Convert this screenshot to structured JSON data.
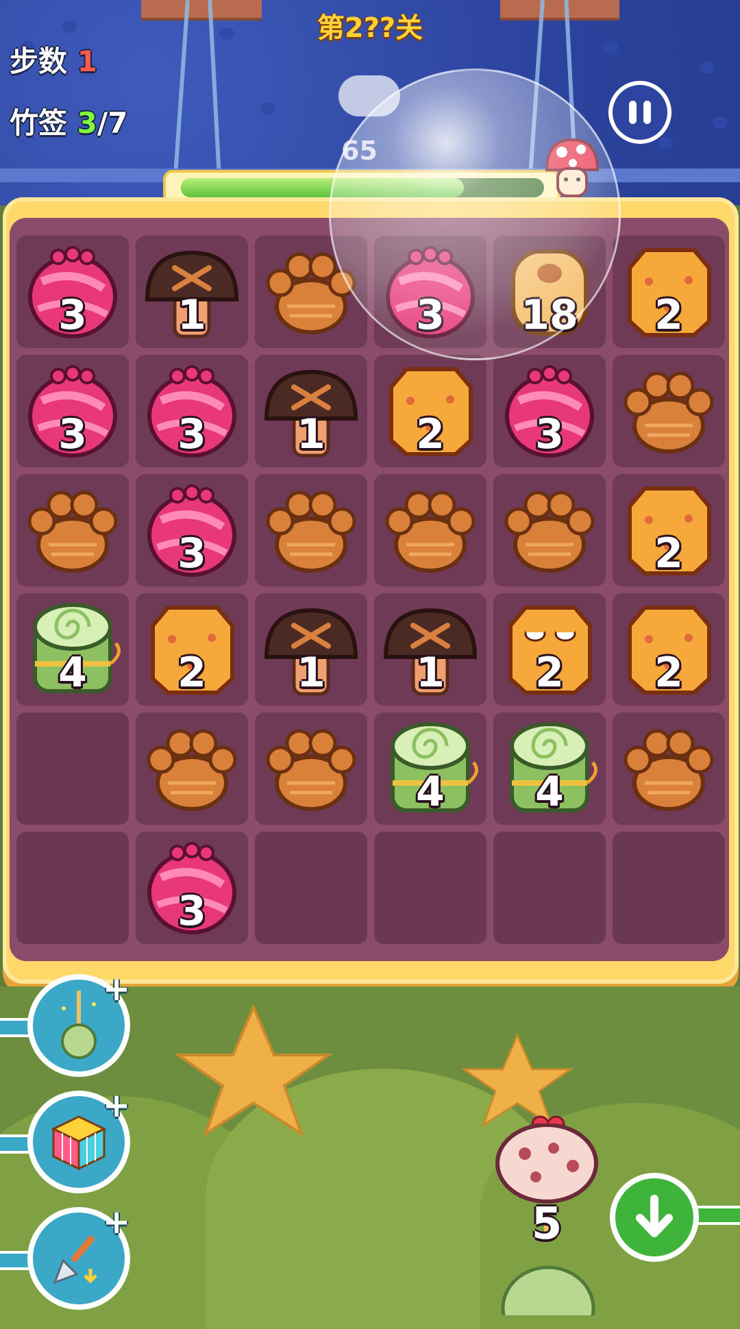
{
  "level": {
    "title": "第2??关"
  },
  "hud": {
    "steps_label": "步数",
    "steps_value": "1",
    "skewers_label": "竹签",
    "skewers_current": "3",
    "skewers_total": "/7"
  },
  "progress": {
    "fraction": 0.78,
    "score_text": "65"
  },
  "colors": {
    "sky": "#2d45a0",
    "board": "#ffd86a",
    "board_inner": "#8a4c6a",
    "ground": "#6d8e3e"
  },
  "board": {
    "rows": [
      [
        {
          "type": "candy",
          "count": "3"
        },
        {
          "type": "mushroom",
          "count": "1"
        },
        {
          "type": "paw",
          "count": ""
        },
        {
          "type": "candy",
          "count": "3"
        },
        {
          "type": "donut",
          "count": "18"
        },
        {
          "type": "cheese",
          "count": "2"
        }
      ],
      [
        {
          "type": "candy",
          "count": "3"
        },
        {
          "type": "candy",
          "count": "3"
        },
        {
          "type": "mushroom",
          "count": "1"
        },
        {
          "type": "cheese",
          "count": "2"
        },
        {
          "type": "candy",
          "count": "3"
        },
        {
          "type": "paw",
          "count": ""
        }
      ],
      [
        {
          "type": "paw",
          "count": ""
        },
        {
          "type": "candy",
          "count": "3"
        },
        {
          "type": "paw",
          "count": ""
        },
        {
          "type": "paw",
          "count": ""
        },
        {
          "type": "paw",
          "count": ""
        },
        {
          "type": "cheese",
          "count": "2"
        }
      ],
      [
        {
          "type": "roll",
          "count": "4"
        },
        {
          "type": "cheese",
          "count": "2"
        },
        {
          "type": "mushroom",
          "count": "1"
        },
        {
          "type": "mushroom",
          "count": "1"
        },
        {
          "type": "cheese-face",
          "count": "2"
        },
        {
          "type": "cheese",
          "count": "2"
        }
      ],
      [
        {
          "type": "empty",
          "count": ""
        },
        {
          "type": "paw",
          "count": ""
        },
        {
          "type": "paw",
          "count": ""
        },
        {
          "type": "roll",
          "count": "4"
        },
        {
          "type": "roll",
          "count": "4"
        },
        {
          "type": "paw",
          "count": ""
        }
      ],
      [
        {
          "type": "empty",
          "count": ""
        },
        {
          "type": "candy",
          "count": "3"
        },
        {
          "type": "empty",
          "count": ""
        },
        {
          "type": "empty",
          "count": ""
        },
        {
          "type": "empty",
          "count": ""
        },
        {
          "type": "empty",
          "count": ""
        }
      ]
    ]
  },
  "boosters": [
    {
      "name": "skewer-booster",
      "icon": "skewer-icon",
      "plus": "+"
    },
    {
      "name": "cube-booster",
      "icon": "rubik-cube-icon",
      "plus": "+"
    },
    {
      "name": "shovel-booster",
      "icon": "shovel-icon",
      "plus": "+"
    }
  ],
  "next_piece": {
    "type": "sausage",
    "count": "5"
  },
  "drop_button": {
    "icon": "down-arrow-icon"
  }
}
